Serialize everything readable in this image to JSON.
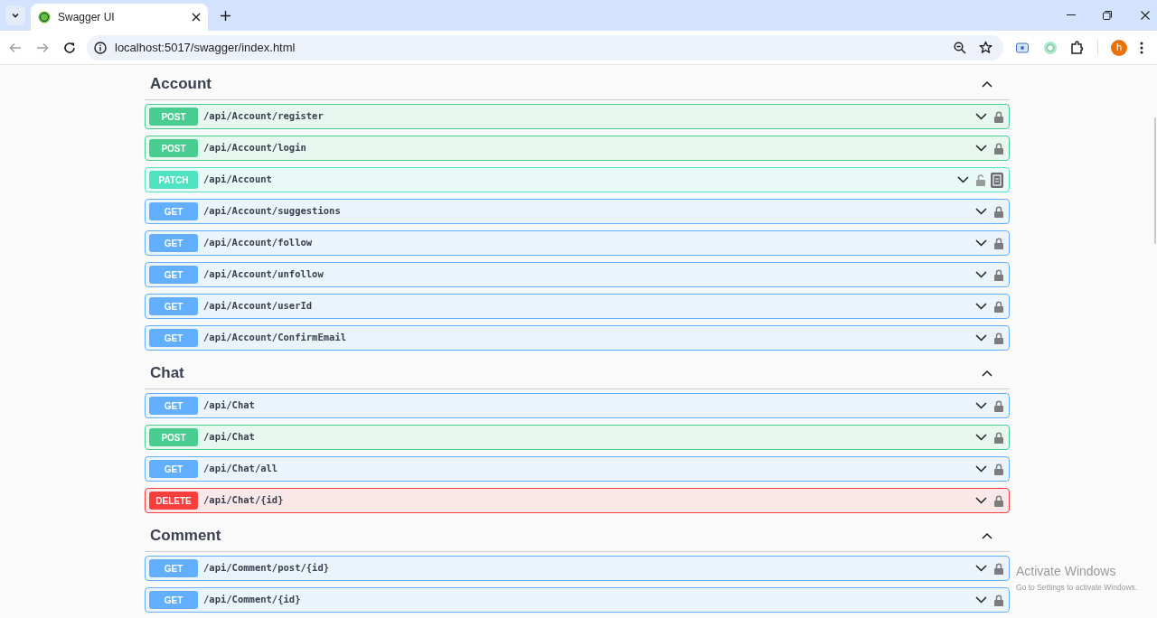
{
  "browser": {
    "tab_title": "Swagger UI",
    "url": "localhost:5017/swagger/index.html",
    "profile_initial": "h"
  },
  "sections": [
    {
      "name": "Account",
      "expanded": true,
      "endpoints": [
        {
          "method": "POST",
          "path": "/api/Account/register",
          "locked": true,
          "copy_icon": false
        },
        {
          "method": "POST",
          "path": "/api/Account/login",
          "locked": true,
          "copy_icon": false
        },
        {
          "method": "PATCH",
          "path": "/api/Account",
          "locked": false,
          "copy_icon": true
        },
        {
          "method": "GET",
          "path": "/api/Account/suggestions",
          "locked": true,
          "copy_icon": false
        },
        {
          "method": "GET",
          "path": "/api/Account/follow",
          "locked": true,
          "copy_icon": false
        },
        {
          "method": "GET",
          "path": "/api/Account/unfollow",
          "locked": true,
          "copy_icon": false
        },
        {
          "method": "GET",
          "path": "/api/Account/userId",
          "locked": true,
          "copy_icon": false
        },
        {
          "method": "GET",
          "path": "/api/Account/ConfirmEmail",
          "locked": true,
          "copy_icon": false
        }
      ]
    },
    {
      "name": "Chat",
      "expanded": true,
      "endpoints": [
        {
          "method": "GET",
          "path": "/api/Chat",
          "locked": true,
          "copy_icon": false
        },
        {
          "method": "POST",
          "path": "/api/Chat",
          "locked": true,
          "copy_icon": false
        },
        {
          "method": "GET",
          "path": "/api/Chat/all",
          "locked": true,
          "copy_icon": false
        },
        {
          "method": "DELETE",
          "path": "/api/Chat/{id}",
          "locked": true,
          "copy_icon": false
        }
      ]
    },
    {
      "name": "Comment",
      "expanded": true,
      "endpoints": [
        {
          "method": "GET",
          "path": "/api/Comment/post/{id}",
          "locked": true,
          "copy_icon": false
        },
        {
          "method": "GET",
          "path": "/api/Comment/{id}",
          "locked": true,
          "copy_icon": false
        }
      ]
    }
  ],
  "os_notice": {
    "title": "Activate Windows",
    "message": "Go to Settings to activate Windows."
  }
}
